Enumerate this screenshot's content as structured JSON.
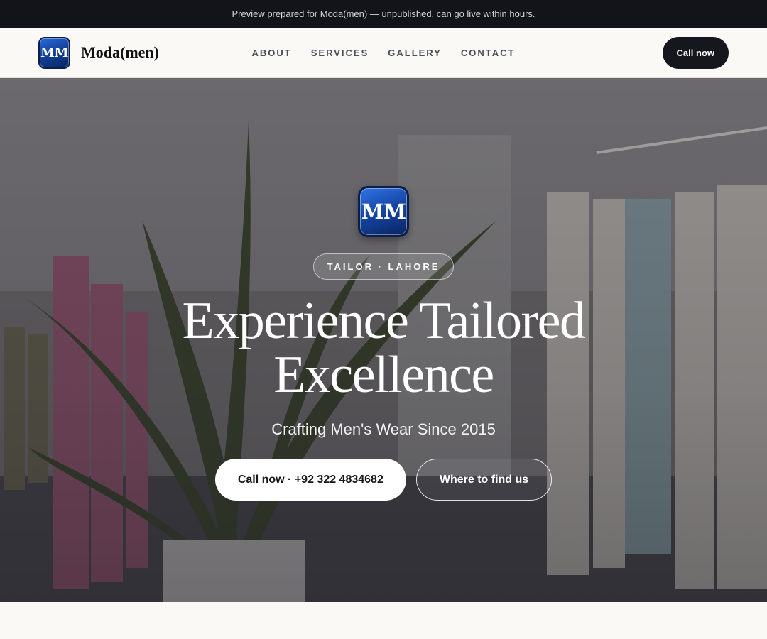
{
  "announcement": "Preview prepared for Moda(men) — unpublished, can go live within hours.",
  "brand": {
    "logo_text": "MM",
    "name": "Moda(men)"
  },
  "nav": {
    "items": [
      {
        "label": "ABOUT"
      },
      {
        "label": "SERVICES"
      },
      {
        "label": "GALLERY"
      },
      {
        "label": "CONTACT"
      }
    ],
    "cta_label": "Call now"
  },
  "hero": {
    "logo_text": "MM",
    "tag": "TAILOR · LAHORE",
    "headline": "Experience Tailored Excellence",
    "subheadline": "Crafting Men's Wear Since 2015",
    "primary_cta": "Call now · +92 322 4834682",
    "secondary_cta": "Where to find us"
  },
  "colors": {
    "topbar_bg": "#121419",
    "brand_blue": "#15439f",
    "dark_button": "#15171c",
    "page_bg": "#faf9f6"
  }
}
